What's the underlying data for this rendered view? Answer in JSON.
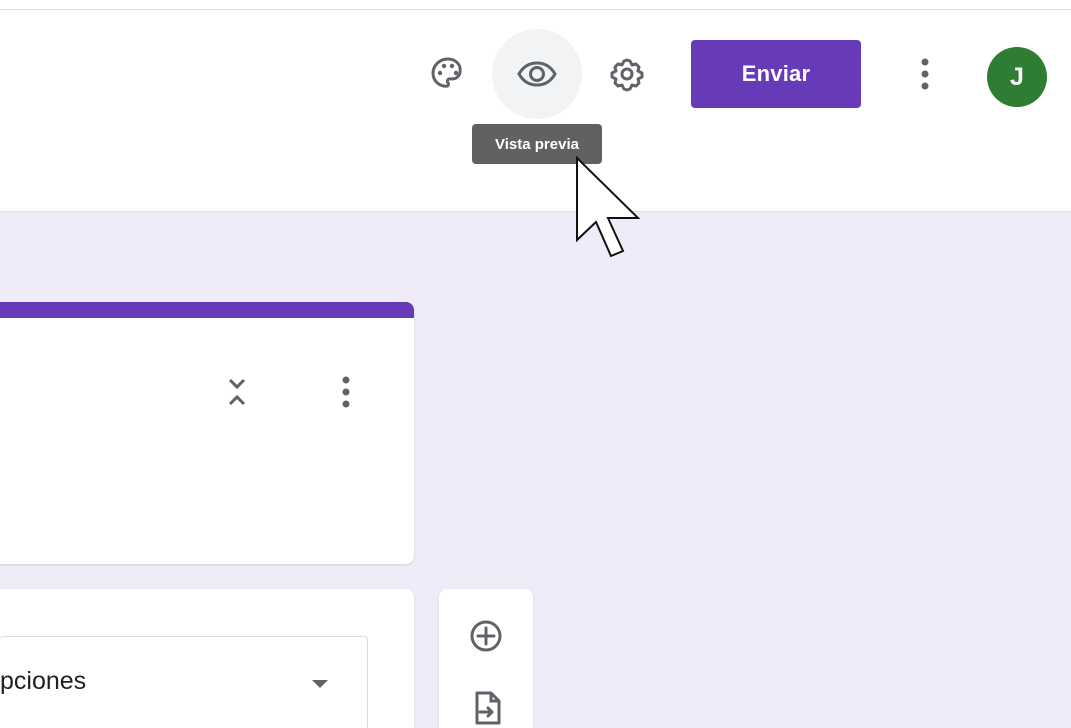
{
  "header": {
    "palette_icon": "palette-icon",
    "preview_icon": "eye-icon",
    "settings_icon": "gear-icon",
    "send_label": "Enviar",
    "more_icon": "vertical-dots-icon",
    "avatar_initial": "J",
    "tooltip_text": "Vista previa"
  },
  "form_card": {
    "collapse_icon": "collapse-expand-icon",
    "more_icon": "vertical-dots-icon"
  },
  "question_card": {
    "type_value": "pciones"
  },
  "side_toolbar": {
    "add_icon": "add-circle-icon",
    "import_icon": "import-question-icon"
  },
  "colors": {
    "accent": "#673ab7",
    "background": "#f0ebf8",
    "avatar": "#2e7d32",
    "tooltip": "#616161"
  }
}
